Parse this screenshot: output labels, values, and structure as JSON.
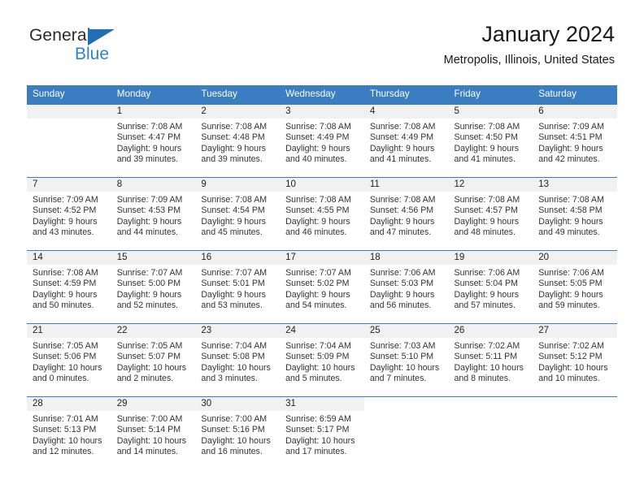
{
  "brand": {
    "name_part1": "General",
    "name_part2": "Blue",
    "triangle_color": "#1f6fb5",
    "accent_color": "#2a84d2"
  },
  "header": {
    "title": "January 2024",
    "location": "Metropolis, Illinois, United States",
    "header_bg": "#3a7dc0",
    "daynum_bg": "#f1f1f1"
  },
  "weekdays": [
    "Sunday",
    "Monday",
    "Tuesday",
    "Wednesday",
    "Thursday",
    "Friday",
    "Saturday"
  ],
  "weeks": [
    [
      {
        "day": "",
        "sunrise": "",
        "sunset": "",
        "daylight_line1": "",
        "daylight_line2": ""
      },
      {
        "day": "1",
        "sunrise": "Sunrise: 7:08 AM",
        "sunset": "Sunset: 4:47 PM",
        "daylight_line1": "Daylight: 9 hours",
        "daylight_line2": "and 39 minutes."
      },
      {
        "day": "2",
        "sunrise": "Sunrise: 7:08 AM",
        "sunset": "Sunset: 4:48 PM",
        "daylight_line1": "Daylight: 9 hours",
        "daylight_line2": "and 39 minutes."
      },
      {
        "day": "3",
        "sunrise": "Sunrise: 7:08 AM",
        "sunset": "Sunset: 4:49 PM",
        "daylight_line1": "Daylight: 9 hours",
        "daylight_line2": "and 40 minutes."
      },
      {
        "day": "4",
        "sunrise": "Sunrise: 7:08 AM",
        "sunset": "Sunset: 4:49 PM",
        "daylight_line1": "Daylight: 9 hours",
        "daylight_line2": "and 41 minutes."
      },
      {
        "day": "5",
        "sunrise": "Sunrise: 7:08 AM",
        "sunset": "Sunset: 4:50 PM",
        "daylight_line1": "Daylight: 9 hours",
        "daylight_line2": "and 41 minutes."
      },
      {
        "day": "6",
        "sunrise": "Sunrise: 7:09 AM",
        "sunset": "Sunset: 4:51 PM",
        "daylight_line1": "Daylight: 9 hours",
        "daylight_line2": "and 42 minutes."
      }
    ],
    [
      {
        "day": "7",
        "sunrise": "Sunrise: 7:09 AM",
        "sunset": "Sunset: 4:52 PM",
        "daylight_line1": "Daylight: 9 hours",
        "daylight_line2": "and 43 minutes."
      },
      {
        "day": "8",
        "sunrise": "Sunrise: 7:09 AM",
        "sunset": "Sunset: 4:53 PM",
        "daylight_line1": "Daylight: 9 hours",
        "daylight_line2": "and 44 minutes."
      },
      {
        "day": "9",
        "sunrise": "Sunrise: 7:08 AM",
        "sunset": "Sunset: 4:54 PM",
        "daylight_line1": "Daylight: 9 hours",
        "daylight_line2": "and 45 minutes."
      },
      {
        "day": "10",
        "sunrise": "Sunrise: 7:08 AM",
        "sunset": "Sunset: 4:55 PM",
        "daylight_line1": "Daylight: 9 hours",
        "daylight_line2": "and 46 minutes."
      },
      {
        "day": "11",
        "sunrise": "Sunrise: 7:08 AM",
        "sunset": "Sunset: 4:56 PM",
        "daylight_line1": "Daylight: 9 hours",
        "daylight_line2": "and 47 minutes."
      },
      {
        "day": "12",
        "sunrise": "Sunrise: 7:08 AM",
        "sunset": "Sunset: 4:57 PM",
        "daylight_line1": "Daylight: 9 hours",
        "daylight_line2": "and 48 minutes."
      },
      {
        "day": "13",
        "sunrise": "Sunrise: 7:08 AM",
        "sunset": "Sunset: 4:58 PM",
        "daylight_line1": "Daylight: 9 hours",
        "daylight_line2": "and 49 minutes."
      }
    ],
    [
      {
        "day": "14",
        "sunrise": "Sunrise: 7:08 AM",
        "sunset": "Sunset: 4:59 PM",
        "daylight_line1": "Daylight: 9 hours",
        "daylight_line2": "and 50 minutes."
      },
      {
        "day": "15",
        "sunrise": "Sunrise: 7:07 AM",
        "sunset": "Sunset: 5:00 PM",
        "daylight_line1": "Daylight: 9 hours",
        "daylight_line2": "and 52 minutes."
      },
      {
        "day": "16",
        "sunrise": "Sunrise: 7:07 AM",
        "sunset": "Sunset: 5:01 PM",
        "daylight_line1": "Daylight: 9 hours",
        "daylight_line2": "and 53 minutes."
      },
      {
        "day": "17",
        "sunrise": "Sunrise: 7:07 AM",
        "sunset": "Sunset: 5:02 PM",
        "daylight_line1": "Daylight: 9 hours",
        "daylight_line2": "and 54 minutes."
      },
      {
        "day": "18",
        "sunrise": "Sunrise: 7:06 AM",
        "sunset": "Sunset: 5:03 PM",
        "daylight_line1": "Daylight: 9 hours",
        "daylight_line2": "and 56 minutes."
      },
      {
        "day": "19",
        "sunrise": "Sunrise: 7:06 AM",
        "sunset": "Sunset: 5:04 PM",
        "daylight_line1": "Daylight: 9 hours",
        "daylight_line2": "and 57 minutes."
      },
      {
        "day": "20",
        "sunrise": "Sunrise: 7:06 AM",
        "sunset": "Sunset: 5:05 PM",
        "daylight_line1": "Daylight: 9 hours",
        "daylight_line2": "and 59 minutes."
      }
    ],
    [
      {
        "day": "21",
        "sunrise": "Sunrise: 7:05 AM",
        "sunset": "Sunset: 5:06 PM",
        "daylight_line1": "Daylight: 10 hours",
        "daylight_line2": "and 0 minutes."
      },
      {
        "day": "22",
        "sunrise": "Sunrise: 7:05 AM",
        "sunset": "Sunset: 5:07 PM",
        "daylight_line1": "Daylight: 10 hours",
        "daylight_line2": "and 2 minutes."
      },
      {
        "day": "23",
        "sunrise": "Sunrise: 7:04 AM",
        "sunset": "Sunset: 5:08 PM",
        "daylight_line1": "Daylight: 10 hours",
        "daylight_line2": "and 3 minutes."
      },
      {
        "day": "24",
        "sunrise": "Sunrise: 7:04 AM",
        "sunset": "Sunset: 5:09 PM",
        "daylight_line1": "Daylight: 10 hours",
        "daylight_line2": "and 5 minutes."
      },
      {
        "day": "25",
        "sunrise": "Sunrise: 7:03 AM",
        "sunset": "Sunset: 5:10 PM",
        "daylight_line1": "Daylight: 10 hours",
        "daylight_line2": "and 7 minutes."
      },
      {
        "day": "26",
        "sunrise": "Sunrise: 7:02 AM",
        "sunset": "Sunset: 5:11 PM",
        "daylight_line1": "Daylight: 10 hours",
        "daylight_line2": "and 8 minutes."
      },
      {
        "day": "27",
        "sunrise": "Sunrise: 7:02 AM",
        "sunset": "Sunset: 5:12 PM",
        "daylight_line1": "Daylight: 10 hours",
        "daylight_line2": "and 10 minutes."
      }
    ],
    [
      {
        "day": "28",
        "sunrise": "Sunrise: 7:01 AM",
        "sunset": "Sunset: 5:13 PM",
        "daylight_line1": "Daylight: 10 hours",
        "daylight_line2": "and 12 minutes."
      },
      {
        "day": "29",
        "sunrise": "Sunrise: 7:00 AM",
        "sunset": "Sunset: 5:14 PM",
        "daylight_line1": "Daylight: 10 hours",
        "daylight_line2": "and 14 minutes."
      },
      {
        "day": "30",
        "sunrise": "Sunrise: 7:00 AM",
        "sunset": "Sunset: 5:16 PM",
        "daylight_line1": "Daylight: 10 hours",
        "daylight_line2": "and 16 minutes."
      },
      {
        "day": "31",
        "sunrise": "Sunrise: 6:59 AM",
        "sunset": "Sunset: 5:17 PM",
        "daylight_line1": "Daylight: 10 hours",
        "daylight_line2": "and 17 minutes."
      },
      {
        "day": "",
        "sunrise": "",
        "sunset": "",
        "daylight_line1": "",
        "daylight_line2": ""
      },
      {
        "day": "",
        "sunrise": "",
        "sunset": "",
        "daylight_line1": "",
        "daylight_line2": ""
      },
      {
        "day": "",
        "sunrise": "",
        "sunset": "",
        "daylight_line1": "",
        "daylight_line2": ""
      }
    ]
  ]
}
